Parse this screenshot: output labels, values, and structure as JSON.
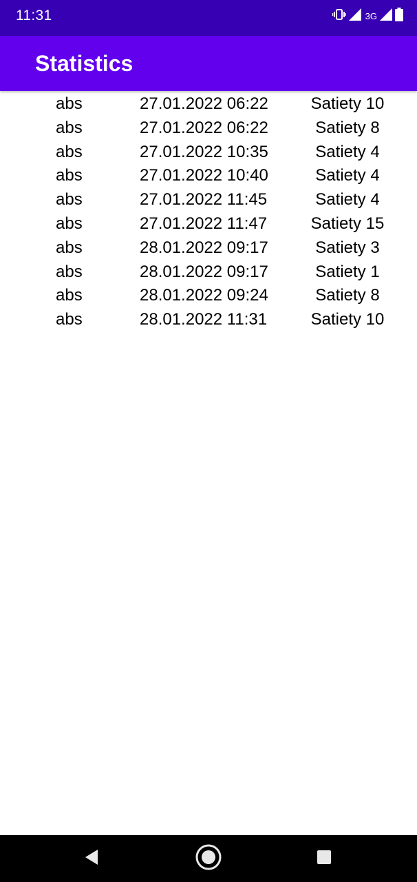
{
  "status_bar": {
    "time": "11:31",
    "network_label": "3G",
    "icons": [
      "vibrate-icon",
      "signal-icon",
      "signal-3g-icon",
      "battery-icon"
    ]
  },
  "app_bar": {
    "title": "Statistics",
    "color": "#6200ee",
    "status_color": "#3700b3"
  },
  "entries": [
    {
      "name": "abs",
      "date": "27.01.2022 06:22",
      "satiety": "Satiety 10"
    },
    {
      "name": "abs",
      "date": "27.01.2022 06:22",
      "satiety": "Satiety 8"
    },
    {
      "name": "abs",
      "date": "27.01.2022 10:35",
      "satiety": "Satiety 4"
    },
    {
      "name": "abs",
      "date": "27.01.2022 10:40",
      "satiety": "Satiety 4"
    },
    {
      "name": "abs",
      "date": "27.01.2022 11:45",
      "satiety": "Satiety 4"
    },
    {
      "name": "abs",
      "date": "27.01.2022 11:47",
      "satiety": "Satiety 15"
    },
    {
      "name": "abs",
      "date": "28.01.2022 09:17",
      "satiety": "Satiety 3"
    },
    {
      "name": "abs",
      "date": "28.01.2022 09:17",
      "satiety": "Satiety 1"
    },
    {
      "name": "abs",
      "date": "28.01.2022 09:24",
      "satiety": "Satiety 8"
    },
    {
      "name": "abs",
      "date": "28.01.2022 11:31",
      "satiety": "Satiety 10"
    }
  ],
  "nav_bar": {
    "icons": [
      "back-icon",
      "home-icon",
      "recents-icon"
    ]
  }
}
